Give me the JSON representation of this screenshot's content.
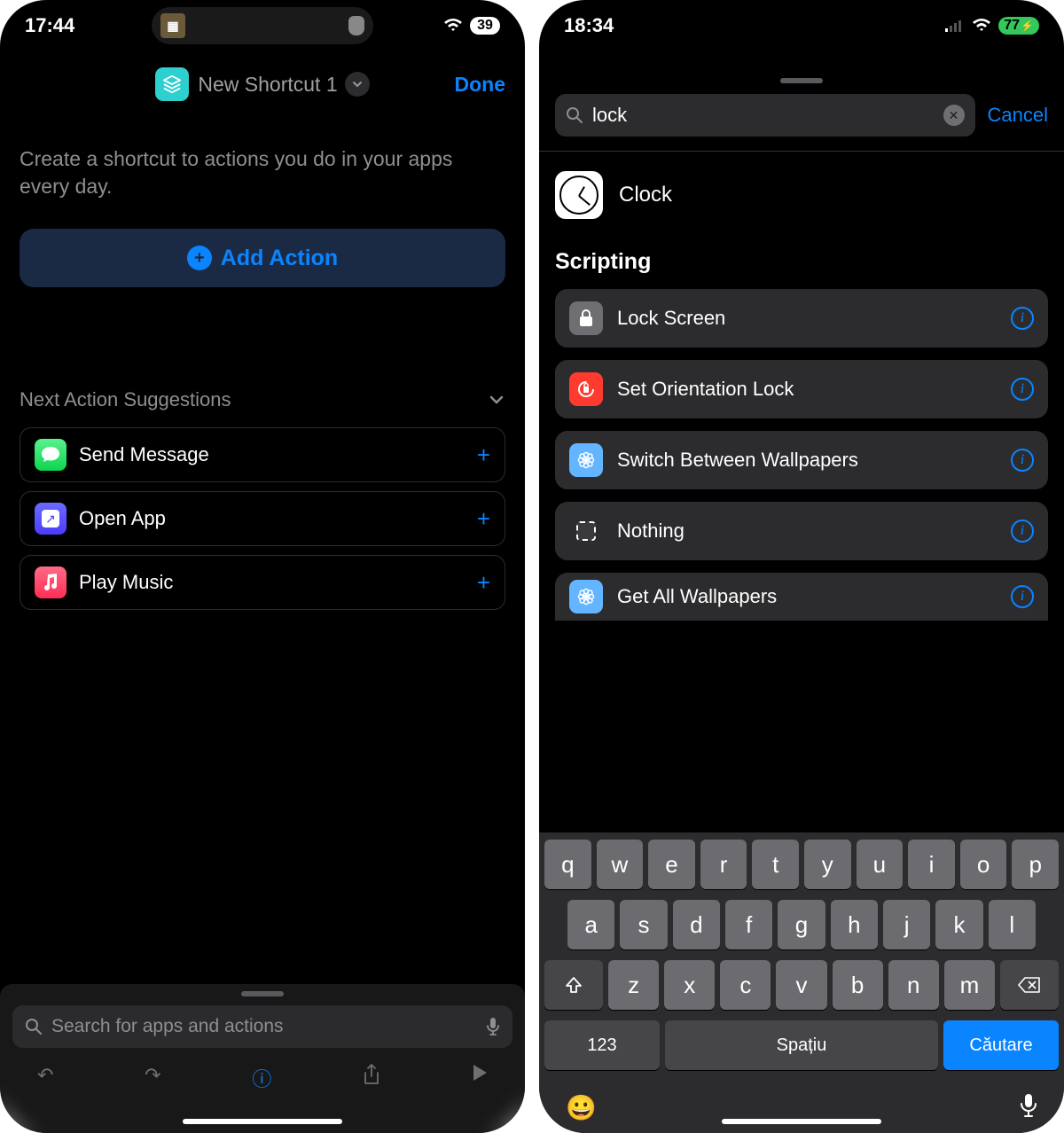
{
  "screen1": {
    "status": {
      "time": "17:44",
      "battery": "39"
    },
    "header": {
      "title": "New Shortcut 1",
      "done": "Done"
    },
    "subtitle": "Create a shortcut to actions you do in your apps every day.",
    "add_action": "Add Action",
    "suggestions_title": "Next Action Suggestions",
    "suggestions": [
      {
        "label": "Send Message"
      },
      {
        "label": "Open App"
      },
      {
        "label": "Play Music"
      }
    ],
    "search_placeholder": "Search for apps and actions"
  },
  "screen2": {
    "status": {
      "time": "18:34",
      "battery": "77"
    },
    "search_value": "lock",
    "cancel": "Cancel",
    "app_result": "Clock",
    "section": "Scripting",
    "actions": [
      {
        "label": "Lock Screen"
      },
      {
        "label": "Set Orientation Lock"
      },
      {
        "label": "Switch Between Wallpapers"
      },
      {
        "label": "Nothing"
      },
      {
        "label": "Get All Wallpapers"
      }
    ],
    "keyboard": {
      "row1": [
        "q",
        "w",
        "e",
        "r",
        "t",
        "y",
        "u",
        "i",
        "o",
        "p"
      ],
      "row2": [
        "a",
        "s",
        "d",
        "f",
        "g",
        "h",
        "j",
        "k",
        "l"
      ],
      "row3": [
        "z",
        "x",
        "c",
        "v",
        "b",
        "n",
        "m"
      ],
      "num": "123",
      "space": "Spațiu",
      "search": "Căutare"
    }
  }
}
